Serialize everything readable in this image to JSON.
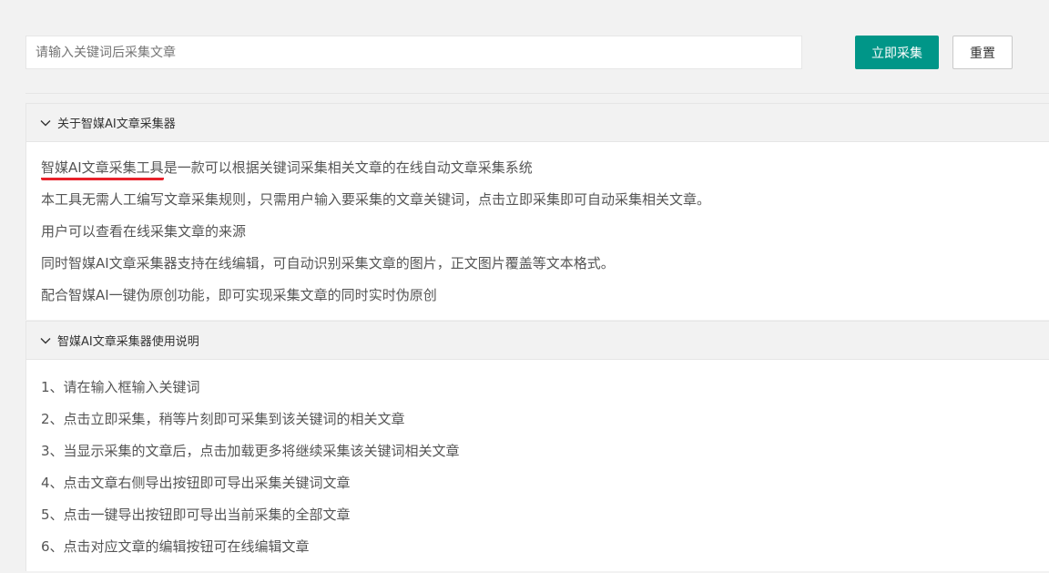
{
  "search": {
    "placeholder": "请输入关键词后采集文章",
    "value": ""
  },
  "buttons": {
    "collect": "立即采集",
    "reset": "重置"
  },
  "about": {
    "title": "关于智媒AI文章采集器",
    "lines": [
      "智媒AI文章采集工具是一款可以根据关键词采集相关文章的在线自动文章采集系统",
      "本工具无需人工编写文章采集规则，只需用户输入要采集的文章关键词，点击立即采集即可自动采集相关文章。",
      "用户可以查看在线采集文章的来源",
      "同时智媒AI文章采集器支持在线编辑，可自动识别采集文章的图片，正文图片覆盖等文本格式。",
      "配合智媒AI一键伪原创功能，即可实现采集文章的同时实时伪原创"
    ],
    "first_line_underlined": "智媒AI文章采集工具",
    "first_line_rest": "是一款可以根据关键词采集相关文章的在线自动文章采集系统"
  },
  "usage": {
    "title": "智媒AI文章采集器使用说明",
    "lines": [
      "1、请在输入框输入关键词",
      "2、点击立即采集，稍等片刻即可采集到该关键词的相关文章",
      "3、当显示采集的文章后，点击加载更多将继续采集该关键词相关文章",
      "4、点击文章右侧导出按钮即可导出采集关键词文章",
      "5、点击一键导出按钮即可导出当前采集的全部文章",
      "6、点击对应文章的编辑按钮可在线编辑文章"
    ]
  },
  "colors": {
    "primary": "#009688",
    "annotation": "#e8212a"
  },
  "icons": {
    "panel_toggle": "chevron-down-icon"
  }
}
